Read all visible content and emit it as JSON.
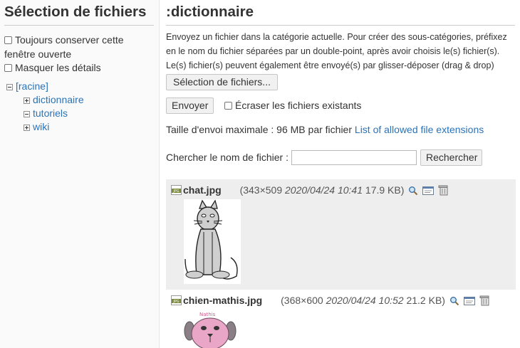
{
  "sidebar": {
    "title": "Sélection de fichiers",
    "options": [
      {
        "label": "Toujours conserver cette fenêtre ouverte"
      },
      {
        "label": "Masquer les détails"
      }
    ],
    "tree": {
      "root": "[racine]",
      "children": [
        "dictionnaire",
        "tutoriels",
        "wiki"
      ]
    }
  },
  "main": {
    "title": ":dictionnaire",
    "intro": "Envoyez un fichier dans la catégorie actuelle. Pour créer des sous-catégories, préfixez en le nom du fichier séparées par un double-point, après avoir choisis le(s) fichier(s). Le(s) fichier(s) peuvent également être envoyé(s) par glisser-déposer (drag & drop)",
    "select_button": "Sélection de fichiers...",
    "upload_button": "Envoyer",
    "overwrite_label": "Écraser les fichiers existants",
    "max_size_text": "Taille d'envoi maximale : 96 MB par fichier",
    "extensions_link": "List of allowed file extensions",
    "search_label": "Chercher le nom de fichier :",
    "search_value": "",
    "search_button": "Rechercher"
  },
  "files": [
    {
      "name": "chat.jpg",
      "dims": "(343×509",
      "date": "2020/04/24 10:41",
      "size": "17.9 KB)"
    },
    {
      "name": "chien-mathis.jpg",
      "dims": "(368×600",
      "date": "2020/04/24 10:52",
      "size": "21.2 KB)"
    }
  ],
  "thumb_caption": "Nathis"
}
